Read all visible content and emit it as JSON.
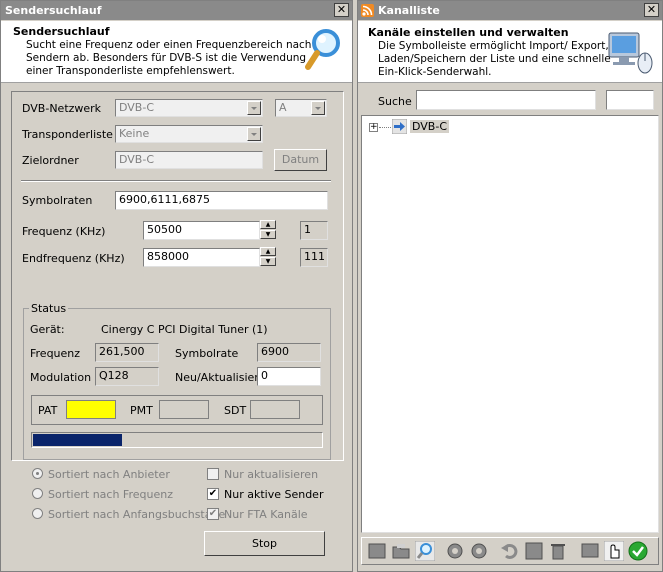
{
  "left": {
    "title": "Sendersuchlauf",
    "close_label": "✕",
    "header_title": "Sendersuchlauf",
    "header_desc1": "Sucht eine Frequenz oder einen Frequenzbereich nach",
    "header_desc2": "Sendern ab. Besonders für DVB-S ist die Verwendung",
    "header_desc3": "einer Transponderliste empfehlenswert.",
    "network_label": "DVB-Netzwerk",
    "network_value": "DVB-C",
    "network_letter": "A",
    "transponder_label": "Transponderliste",
    "transponder_value": "Keine",
    "target_label": "Zielordner",
    "target_value": "DVB-C",
    "datum_button": "Datum",
    "symbol_label": "Symbolraten",
    "symbol_value": "6900,6111,6875",
    "freq_label": "Frequenz (KHz)",
    "freq_value": "50500",
    "freq_count": "1",
    "endfreq_label": "Endfrequenz (KHz)",
    "endfreq_value": "858000",
    "endfreq_count": "111",
    "status": {
      "legend": "Status",
      "device_label": "Gerät:",
      "device_value": "Cinergy C PCI Digital Tuner (1)",
      "freq_label": "Frequenz",
      "freq_value": "261,500",
      "symbol_label": "Symbolrate",
      "symbol_value": "6900",
      "mod_label": "Modulation",
      "mod_value": "Q128",
      "new_label": "Neu/Aktualisiert",
      "new_value": "0",
      "pat_label": "PAT",
      "pmt_label": "PMT",
      "sdt_label": "SDT",
      "pat_color": "#ffff00",
      "progress": 0.31
    },
    "sort_provider": "Sortiert nach Anbieter",
    "sort_freq": "Sortiert nach Frequenz",
    "sort_alpha": "Sortiert nach Anfangsbuchstabe",
    "only_update": "Nur aktualisieren",
    "only_active": "Nur aktive Sender",
    "only_fta": "Nur FTA Kanäle",
    "stop_button": "Stop"
  },
  "right": {
    "title": "Kanalliste",
    "close_label": "✕",
    "header_title": "Kanäle einstellen und verwalten",
    "header_desc1": "Die Symbolleiste ermöglicht Import/ Export,",
    "header_desc2": "Laden/Speichern der Liste und eine schnelle",
    "header_desc3": "Ein-Klick-Senderwahl.",
    "search_label": "Suche",
    "search_value": "",
    "tree_item": "DVB-C",
    "tree_expander": "+"
  },
  "colors": {
    "progress": "#0a246a",
    "titlebar": "#8a8a8a"
  }
}
